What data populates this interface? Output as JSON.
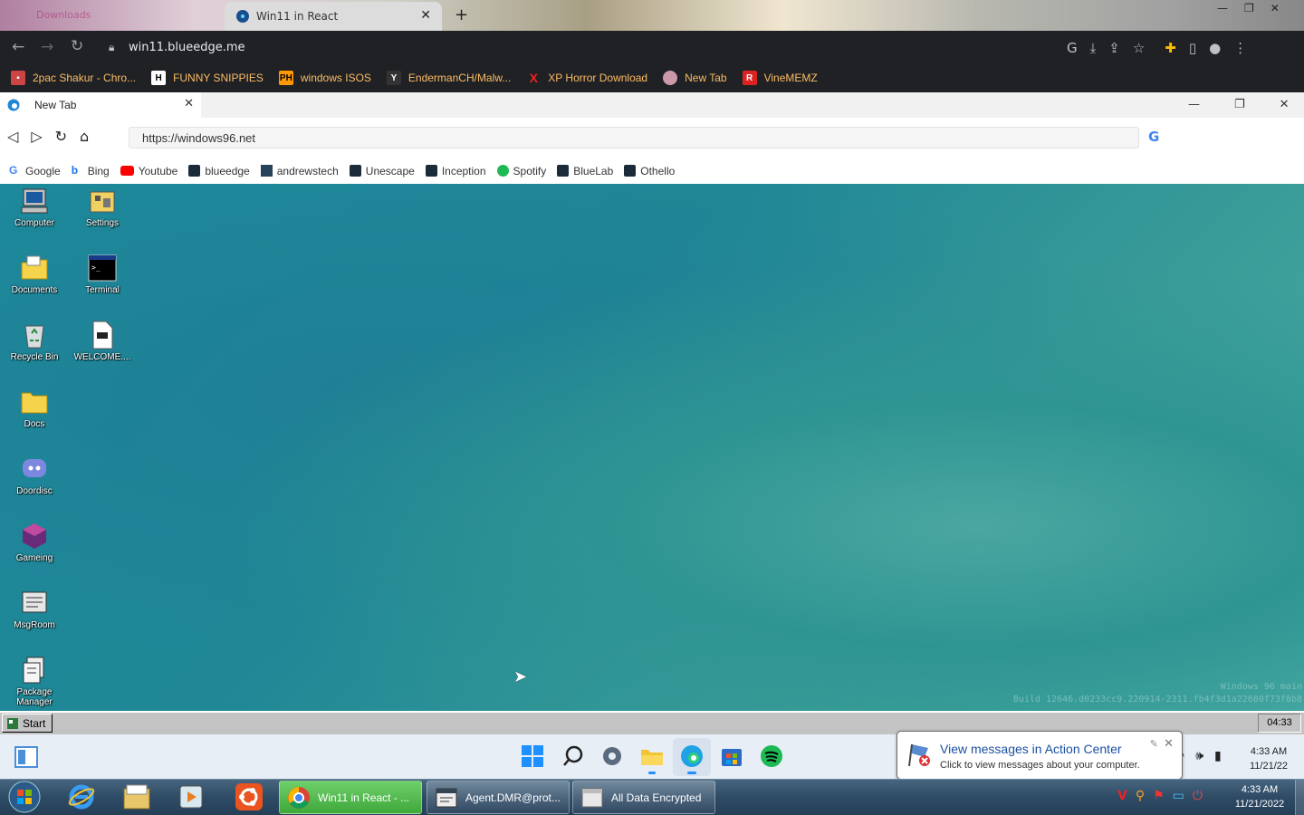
{
  "outer_browser": {
    "tabs": [
      {
        "label": "Downloads",
        "active": false
      },
      {
        "label": "Win11 in React",
        "active": true
      }
    ],
    "address": "win11.blueedge.me",
    "bookmarks": [
      {
        "label": "2pac Shakur - Chro...",
        "icon": "chrome-app-icon"
      },
      {
        "label": "FUNNY SNIPPIES",
        "icon": "h-logo-icon"
      },
      {
        "label": "windows ISOS",
        "icon": "ph-logo-icon"
      },
      {
        "label": "EndermanCH/Malw...",
        "icon": "yp-logo-icon"
      },
      {
        "label": "XP Horror Download",
        "icon": "x-logo-icon"
      },
      {
        "label": "New Tab",
        "icon": "globe-icon"
      },
      {
        "label": "VineMEMZ",
        "icon": "r-logo-icon"
      }
    ]
  },
  "inner_browser": {
    "tab_label": "New Tab",
    "url": "https://windows96.net",
    "bookmarks": [
      {
        "label": "Google",
        "icon": "google-icon"
      },
      {
        "label": "Bing",
        "icon": "bing-icon"
      },
      {
        "label": "Youtube",
        "icon": "youtube-icon"
      },
      {
        "label": "blueedge",
        "icon": "react-icon"
      },
      {
        "label": "andrewstech",
        "icon": "andrewstech-icon"
      },
      {
        "label": "Unescape",
        "icon": "react-icon"
      },
      {
        "label": "Inception",
        "icon": "react-icon"
      },
      {
        "label": "Spotify",
        "icon": "spotify-icon"
      },
      {
        "label": "BlueLab",
        "icon": "react-icon"
      },
      {
        "label": "Othello",
        "icon": "react-icon"
      }
    ]
  },
  "desktop": {
    "icons": [
      {
        "label": "Computer",
        "icon": "computer-icon"
      },
      {
        "label": "Settings",
        "icon": "settings-icon"
      },
      {
        "label": "Documents",
        "icon": "documents-folder-icon"
      },
      {
        "label": "Terminal",
        "icon": "terminal-icon"
      },
      {
        "label": "Recycle Bin",
        "icon": "recycle-bin-icon"
      },
      {
        "label": "WELCOME....",
        "icon": "markdown-file-icon"
      },
      {
        "label": "Docs",
        "icon": "folder-icon"
      },
      {
        "label": "Doordisc",
        "icon": "discord-icon"
      },
      {
        "label": "Gameing",
        "icon": "cube-icon"
      },
      {
        "label": "MsgRoom",
        "icon": "msgroom-icon"
      },
      {
        "label": "Package Manager",
        "icon": "package-manager-icon"
      }
    ],
    "build_line1": "Windows 96 main",
    "build_line2": "Build 12646.d0233cc9.220914-2311.fb4f3d1a22680f73f8b8"
  },
  "w96_taskbar": {
    "start_label": "Start",
    "clock": "04:33"
  },
  "notification": {
    "title": "View messages in Action Center",
    "subtitle": "Click to view messages about your computer."
  },
  "w11_taskbar": {
    "icons": [
      "windows-start-icon",
      "search-icon",
      "settings-gear-icon",
      "file-explorer-icon",
      "edge-icon",
      "store-icon",
      "spotify-icon"
    ],
    "time": "4:33 AM",
    "date": "11/21/22"
  },
  "w7_taskbar": {
    "pinned": [
      "windows7-orb-icon",
      "internet-explorer-icon",
      "file-explorer-icon",
      "media-player-icon",
      "ubuntu-icon"
    ],
    "windows": [
      {
        "label": "Win11 in React - ...",
        "active": true
      },
      {
        "label": "Agent.DMR@prot...",
        "active": false
      },
      {
        "label": "All Data Encrypted",
        "active": false
      }
    ],
    "time": "4:33 AM",
    "date": "11/21/2022"
  },
  "colors": {
    "chrome_dark": "#202124",
    "bookmark_text": "#fbbc65",
    "desktop_teal": "#1f8796",
    "w7_active_button": "#3ea83a"
  }
}
